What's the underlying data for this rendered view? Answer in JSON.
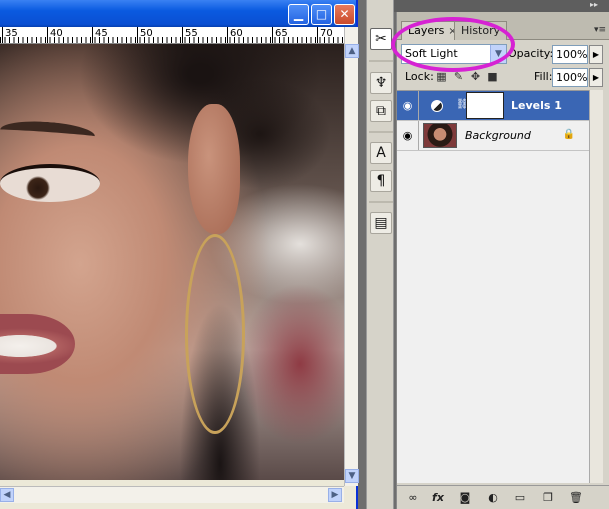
{
  "document": {
    "ruler_numbers": [
      "35",
      "40",
      "45",
      "50",
      "55",
      "60",
      "65",
      "70"
    ],
    "window_buttons": {
      "minimize": "▁",
      "maximize": "□",
      "close": "✕"
    }
  },
  "dock": {
    "collapse_glyph": "◂◂",
    "expand_glyph": "▸▸",
    "icons": [
      "tools-icon",
      "brush-icon",
      "clone-source-icon",
      "character-icon",
      "paragraph-icon",
      "notes-icon"
    ]
  },
  "layers_panel": {
    "tabs": [
      {
        "label": "Layers",
        "close": "×",
        "active": true
      },
      {
        "label": "History",
        "active": false
      }
    ],
    "menu_glyph": "▾≡",
    "blend_mode": "Soft Light",
    "opacity_label": "Opacity:",
    "opacity_value": "100%",
    "lock_label": "Lock:",
    "fill_label": "Fill:",
    "fill_value": "100%",
    "layers": [
      {
        "name": "Levels 1",
        "selected": true
      },
      {
        "name": "Background",
        "selected": false
      }
    ]
  },
  "colors": {
    "highlight": "#d622d3",
    "selected_layer": "#3a66b4",
    "titlebar": "#0a5ae0"
  }
}
